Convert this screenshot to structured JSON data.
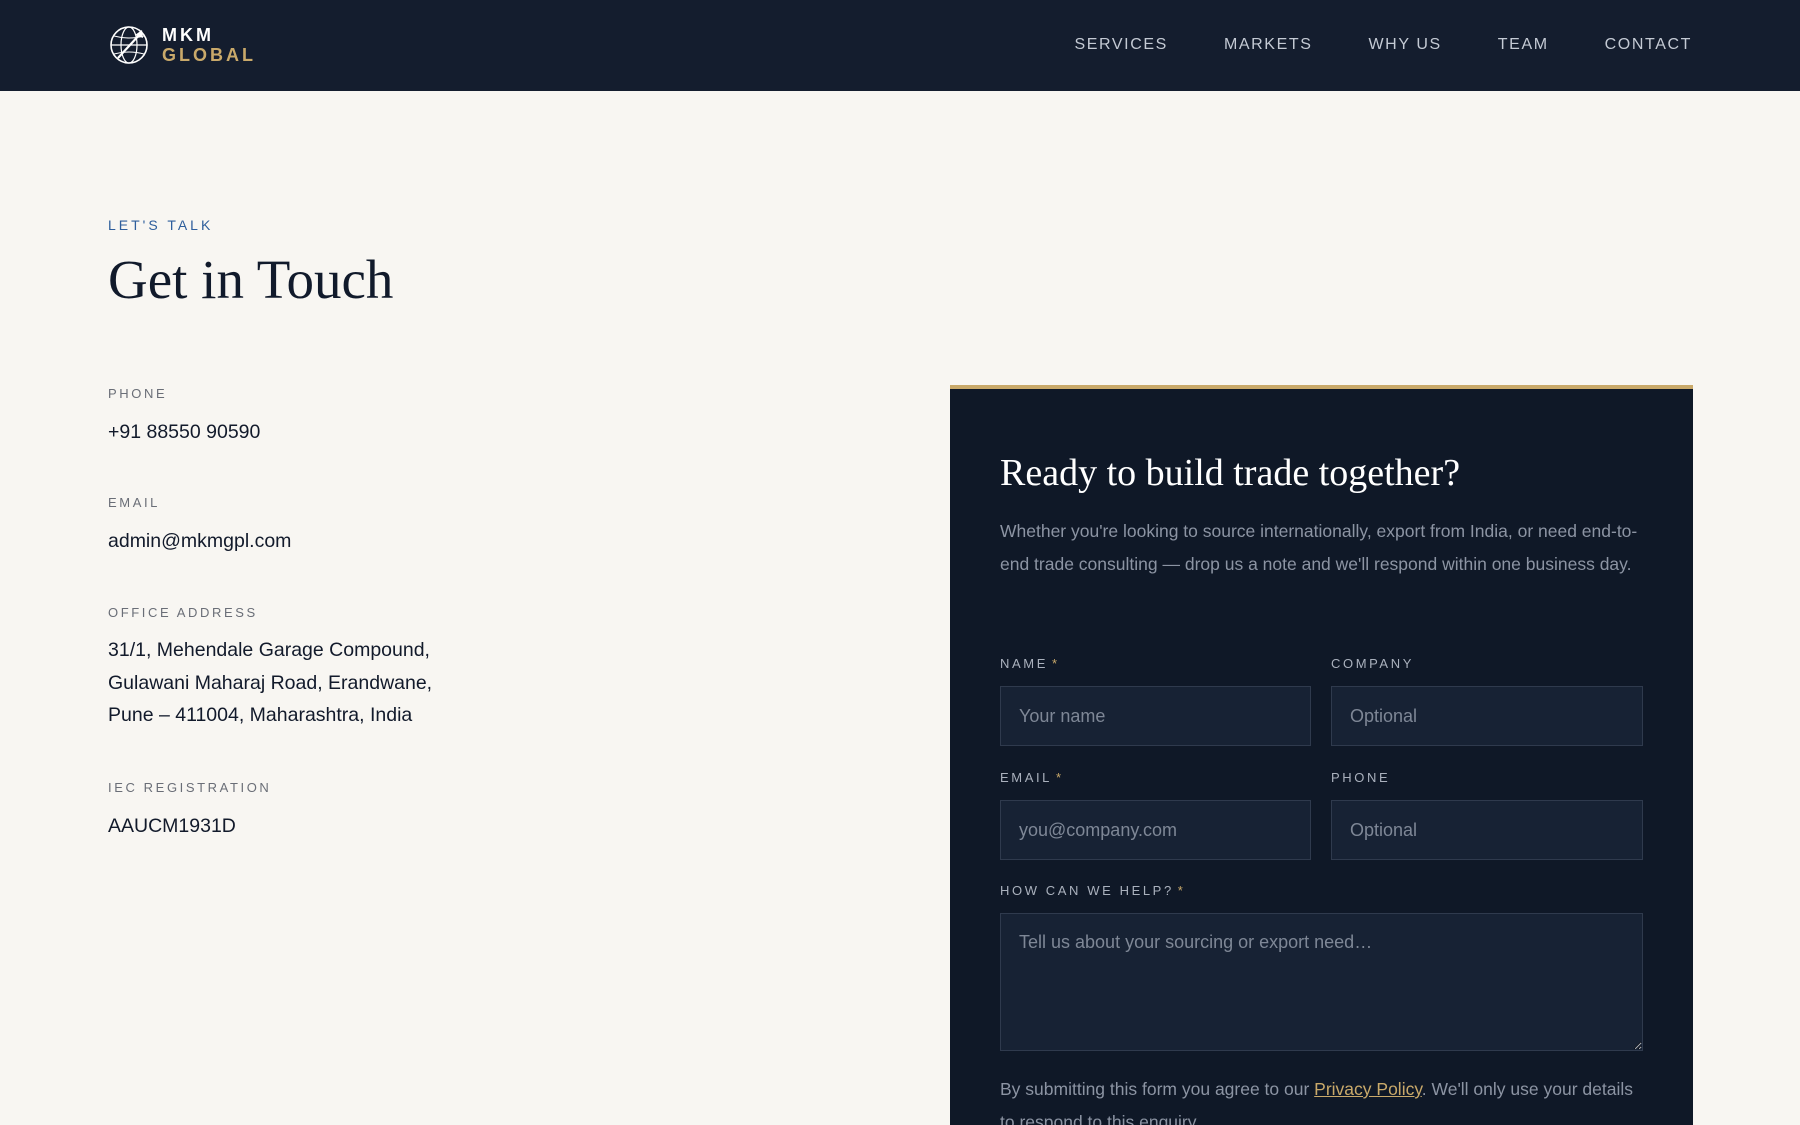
{
  "header": {
    "brand_line1": "MKM",
    "brand_line2": "GLOBAL",
    "logo_icon": "globe-arrow-icon",
    "nav": [
      {
        "label": "SERVICES"
      },
      {
        "label": "MARKETS"
      },
      {
        "label": "WHY US"
      },
      {
        "label": "TEAM"
      },
      {
        "label": "CONTACT"
      }
    ]
  },
  "contact": {
    "eyebrow": "LET'S TALK",
    "title": "Get in Touch",
    "phone_label": "PHONE",
    "phone_value": "+91 88550 90590",
    "email_label": "EMAIL",
    "email_value": "admin@mkmgpl.com",
    "address_label": "OFFICE ADDRESS",
    "address_lines": [
      "31/1, Mehendale Garage Compound,",
      "Gulawani Maharaj Road, Erandwane,",
      "Pune – 411004, Maharashtra, India"
    ],
    "iec_label": "IEC REGISTRATION",
    "iec_value": "AAUCM1931D"
  },
  "form": {
    "title": "Ready to build trade together?",
    "description": "Whether you're looking to source internationally, export from India, or need end-to-end trade consulting — drop us a note and we'll respond within one business day.",
    "required_marker": "*",
    "name_label": "NAME",
    "name_placeholder": "Your name",
    "company_label": "COMPANY",
    "company_placeholder": "Optional",
    "email_label": "EMAIL",
    "email_placeholder": "you@company.com",
    "phone_label": "PHONE",
    "phone_placeholder": "Optional",
    "message_label": "HOW CAN WE HELP?",
    "message_placeholder": "Tell us about your sourcing or export need…",
    "consent_prefix": "By submitting this form you agree to our ",
    "consent_link": "Privacy Policy",
    "consent_suffix": ". We'll only use your details to respond to this enquiry."
  },
  "colors": {
    "header_bg": "#141d2e",
    "page_bg": "#f8f6f2",
    "card_bg": "#0f1827",
    "accent_gold": "#c9a96a",
    "eyebrow_blue": "#2e5e9c"
  }
}
